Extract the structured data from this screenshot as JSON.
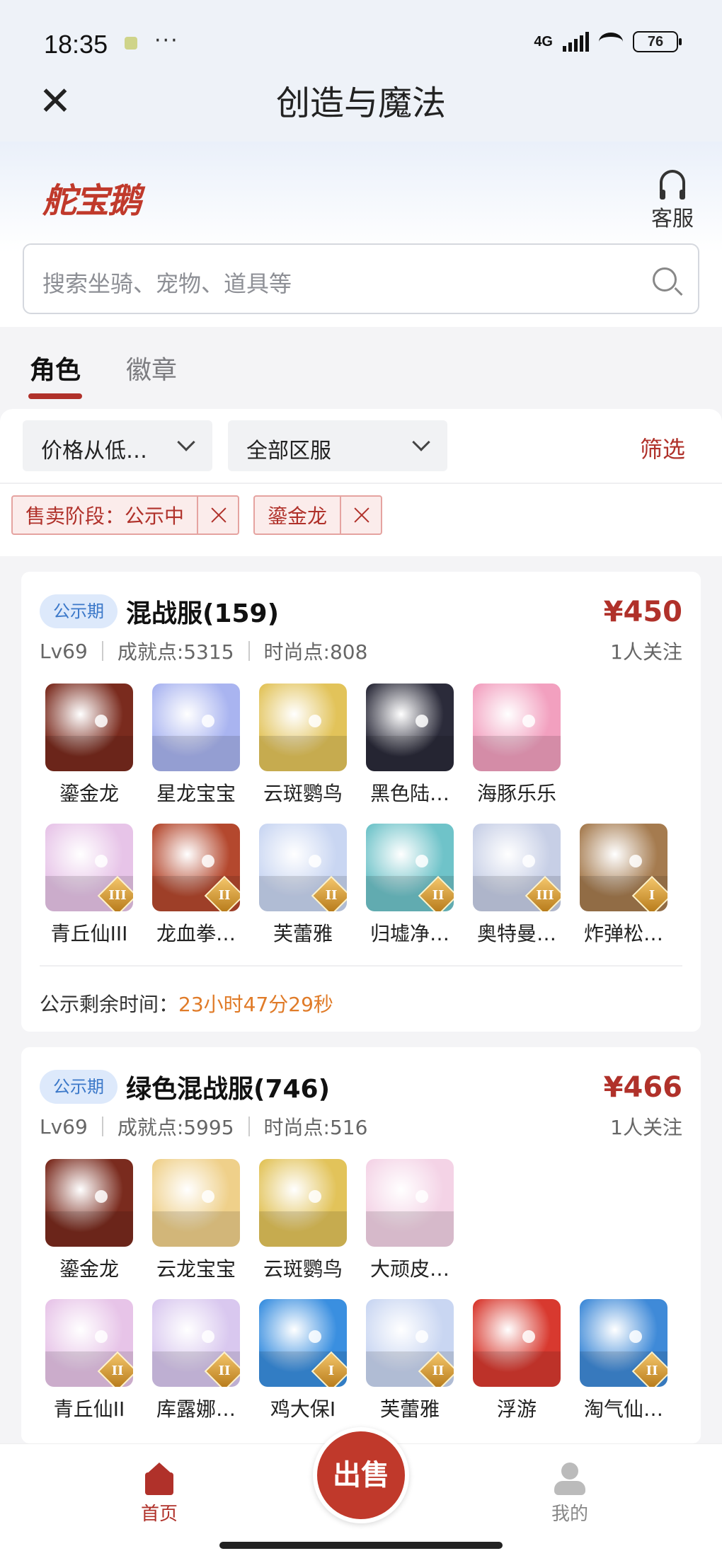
{
  "status_bar": {
    "time": "18:35",
    "dots": "···",
    "network": "4G",
    "battery": "76"
  },
  "nav": {
    "title": "创造与魔法"
  },
  "header": {
    "logo_text": "舵宝鹅",
    "service_label": "客服",
    "search_placeholder": "搜索坐骑、宠物、道具等"
  },
  "tabs": [
    {
      "label": "角色",
      "active": true
    },
    {
      "label": "徽章",
      "active": false
    }
  ],
  "filters": {
    "sort_label": "价格从低…",
    "server_label": "全部区服",
    "filter_label": "筛选",
    "chips": [
      {
        "label": "售卖阶段：公示中"
      },
      {
        "label": "鎏金龙"
      }
    ]
  },
  "listings": [
    {
      "badge": "公示期",
      "name": "混战服(159)",
      "price": "¥450",
      "followers": "1人关注",
      "level": "Lv69",
      "achievement": "成就点:5315",
      "fashion": "时尚点:808",
      "row1": [
        {
          "name": "鎏金龙",
          "color": "#7a2b1e",
          "tier": ""
        },
        {
          "name": "星龙宝宝",
          "color": "#a9b4f0",
          "tier": ""
        },
        {
          "name": "云斑鹦鸟",
          "color": "#e2c35a",
          "tier": ""
        },
        {
          "name": "黑色陆…",
          "color": "#2b2b3a",
          "tier": ""
        },
        {
          "name": "海豚乐乐",
          "color": "#f2a0bf",
          "tier": ""
        }
      ],
      "row2": [
        {
          "name": "青丘仙III",
          "color": "#e7c4e8",
          "tier": "III"
        },
        {
          "name": "龙血拳…",
          "color": "#b4482e",
          "tier": "II"
        },
        {
          "name": "芙蕾雅",
          "color": "#c9d6f2",
          "tier": "II"
        },
        {
          "name": "归墟净…",
          "color": "#6fc3c9",
          "tier": "II"
        },
        {
          "name": "奥特曼…",
          "color": "#c7cfe6",
          "tier": "III"
        },
        {
          "name": "炸弹松…",
          "color": "#a57b4f",
          "tier": "I"
        }
      ],
      "countdown_label": "公示剩余时间：",
      "countdown_value": "23小时47分29秒"
    },
    {
      "badge": "公示期",
      "name": "绿色混战服(746)",
      "price": "¥466",
      "followers": "1人关注",
      "level": "Lv69",
      "achievement": "成就点:5995",
      "fashion": "时尚点:516",
      "row1": [
        {
          "name": "鎏金龙",
          "color": "#7a2b1e",
          "tier": ""
        },
        {
          "name": "云龙宝宝",
          "color": "#efd08a",
          "tier": ""
        },
        {
          "name": "云斑鹦鸟",
          "color": "#e2c35a",
          "tier": ""
        },
        {
          "name": "大顽皮…",
          "color": "#f4d3e6",
          "tier": ""
        }
      ],
      "row2": [
        {
          "name": "青丘仙II",
          "color": "#e7c4e8",
          "tier": "II"
        },
        {
          "name": "库露娜…",
          "color": "#d9c8ef",
          "tier": "II"
        },
        {
          "name": "鸡大保I",
          "color": "#3a8fe0",
          "tier": "I"
        },
        {
          "name": "芙蕾雅",
          "color": "#c9d6f2",
          "tier": "II"
        },
        {
          "name": "浮游",
          "color": "#d8392f",
          "tier": ""
        },
        {
          "name": "淘气仙…",
          "color": "#3f8ad8",
          "tier": "II"
        }
      ]
    }
  ],
  "tabbar": {
    "home_label": "首页",
    "sell_label": "出售",
    "me_label": "我的"
  },
  "colors": {
    "accent": "#b0312a",
    "badge_bg": "#dde9fb",
    "badge_text": "#3b78c9",
    "countdown": "#e07b28"
  }
}
